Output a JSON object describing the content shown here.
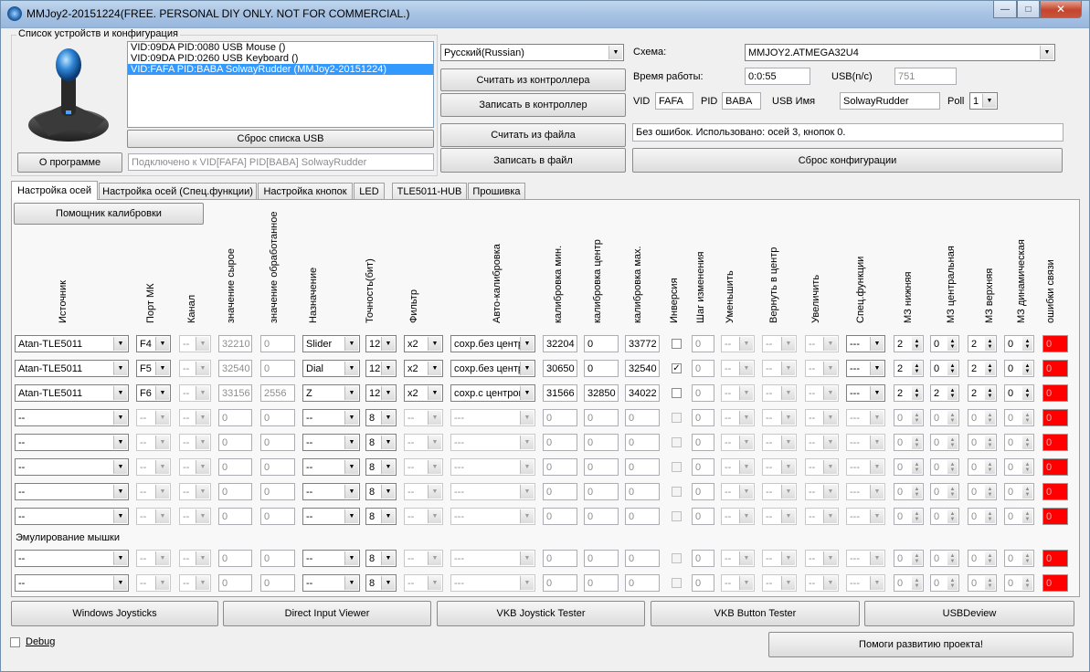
{
  "window": {
    "title": "MMJoy2-20151224(FREE. PERSONAL DIY ONLY. NOT FOR COMMERCIAL.)",
    "btn_min": "—",
    "btn_max": "□",
    "btn_close": "✕"
  },
  "devices": {
    "group_label": "Список устройств и конфигурация",
    "items": [
      "VID:09DA PID:0080 USB Mouse ()",
      "VID:09DA PID:0260 USB Keyboard ()",
      "VID:FAFA PID:BABA SolwayRudder (MMJoy2-20151224)"
    ],
    "reset_usb_label": "Сброс списка USB",
    "about_label": "О программе",
    "connected_text": "Подключено к VID[FAFA] PID[BABA] SolwayRudder"
  },
  "actions": {
    "language": "Русский(Russian)",
    "read_controller": "Считать из контроллера",
    "write_controller": "Записать в контроллер",
    "read_file": "Считать из файла",
    "write_file": "Записать в файл"
  },
  "config": {
    "scheme_label": "Схема:",
    "scheme_value": "MMJOY2.ATMEGA32U4",
    "uptime_label": "Время работы:",
    "uptime_value": "0:0:55",
    "usb_label": "USB(n/c)",
    "usb_value": "751",
    "vid_label": "VID",
    "vid_value": "FAFA",
    "pid_label": "PID",
    "pid_value": "BABA",
    "usbname_label": "USB Имя",
    "usbname_value": "SolwayRudder",
    "poll_label": "Poll",
    "poll_value": "1",
    "status_text": "Без ошибок. Использовано: осей  3, кнопок  0.",
    "reset_config_label": "Сброс конфигурации"
  },
  "tabs": [
    "Настройка осей",
    "Настройка осей (Спец.функции)",
    "Настройка кнопок",
    "LED",
    "TLE5011-HUB",
    "Прошивка"
  ],
  "calibration_helper": "Помощник калибровки",
  "columns": [
    "Источник",
    "Порт МК",
    "Канал",
    "значение сырое",
    "значение обработанное",
    "Назначение",
    "Точность(бит)",
    "Фильтр",
    "Авто-калибровка",
    "калибровка мин.",
    "калибровка центр",
    "калибровка мах.",
    "Инверсия",
    "Шаг изменения",
    "Уменьшить",
    "Вернуть в центр",
    "Увеличить",
    "Спец.функции",
    "МЗ нижняя",
    "МЗ центральная",
    "МЗ верхняя",
    "МЗ динамическая",
    "ошибки связи"
  ],
  "axes": [
    {
      "src": "Atan-TLE5011",
      "port": "F4",
      "ch": "--",
      "raw": "32210",
      "proc": "0",
      "dest": "Slider",
      "bits": "12",
      "filt": "x2",
      "auto": "сохр.без центр",
      "cmin": "32204",
      "cctr": "0",
      "cmax": "33772",
      "inv": false,
      "step": "0",
      "dec": "--",
      "ctr": "--",
      "inc": "--",
      "spec": "---",
      "dzl": "2",
      "dzc": "0",
      "dzu": "2",
      "dzd": "0",
      "err": "0",
      "active": true
    },
    {
      "src": "Atan-TLE5011",
      "port": "F5",
      "ch": "--",
      "raw": "32540",
      "proc": "0",
      "dest": "Dial",
      "bits": "12",
      "filt": "x2",
      "auto": "сохр.без центр",
      "cmin": "30650",
      "cctr": "0",
      "cmax": "32540",
      "inv": true,
      "step": "0",
      "dec": "--",
      "ctr": "--",
      "inc": "--",
      "spec": "---",
      "dzl": "2",
      "dzc": "0",
      "dzu": "2",
      "dzd": "0",
      "err": "0",
      "active": true
    },
    {
      "src": "Atan-TLE5011",
      "port": "F6",
      "ch": "--",
      "raw": "33156",
      "proc": "2556",
      "dest": "Z",
      "bits": "12",
      "filt": "x2",
      "auto": "сохр.с центрои",
      "cmin": "31566",
      "cctr": "32850",
      "cmax": "34022",
      "inv": false,
      "step": "0",
      "dec": "--",
      "ctr": "--",
      "inc": "--",
      "spec": "---",
      "dzl": "2",
      "dzc": "2",
      "dzu": "2",
      "dzd": "0",
      "err": "0",
      "active": true
    },
    {
      "src": "--",
      "port": "--",
      "ch": "--",
      "raw": "0",
      "proc": "0",
      "dest": "--",
      "bits": "8",
      "filt": "--",
      "auto": "---",
      "cmin": "0",
      "cctr": "0",
      "cmax": "0",
      "inv": false,
      "step": "0",
      "dec": "--",
      "ctr": "--",
      "inc": "--",
      "spec": "---",
      "dzl": "0",
      "dzc": "0",
      "dzu": "0",
      "dzd": "0",
      "err": "0",
      "active": false
    },
    {
      "src": "--",
      "port": "--",
      "ch": "--",
      "raw": "0",
      "proc": "0",
      "dest": "--",
      "bits": "8",
      "filt": "--",
      "auto": "---",
      "cmin": "0",
      "cctr": "0",
      "cmax": "0",
      "inv": false,
      "step": "0",
      "dec": "--",
      "ctr": "--",
      "inc": "--",
      "spec": "---",
      "dzl": "0",
      "dzc": "0",
      "dzu": "0",
      "dzd": "0",
      "err": "0",
      "active": false
    },
    {
      "src": "--",
      "port": "--",
      "ch": "--",
      "raw": "0",
      "proc": "0",
      "dest": "--",
      "bits": "8",
      "filt": "--",
      "auto": "---",
      "cmin": "0",
      "cctr": "0",
      "cmax": "0",
      "inv": false,
      "step": "0",
      "dec": "--",
      "ctr": "--",
      "inc": "--",
      "spec": "---",
      "dzl": "0",
      "dzc": "0",
      "dzu": "0",
      "dzd": "0",
      "err": "0",
      "active": false
    },
    {
      "src": "--",
      "port": "--",
      "ch": "--",
      "raw": "0",
      "proc": "0",
      "dest": "--",
      "bits": "8",
      "filt": "--",
      "auto": "---",
      "cmin": "0",
      "cctr": "0",
      "cmax": "0",
      "inv": false,
      "step": "0",
      "dec": "--",
      "ctr": "--",
      "inc": "--",
      "spec": "---",
      "dzl": "0",
      "dzc": "0",
      "dzu": "0",
      "dzd": "0",
      "err": "0",
      "active": false
    },
    {
      "src": "--",
      "port": "--",
      "ch": "--",
      "raw": "0",
      "proc": "0",
      "dest": "--",
      "bits": "8",
      "filt": "--",
      "auto": "---",
      "cmin": "0",
      "cctr": "0",
      "cmax": "0",
      "inv": false,
      "step": "0",
      "dec": "--",
      "ctr": "--",
      "inc": "--",
      "spec": "---",
      "dzl": "0",
      "dzc": "0",
      "dzu": "0",
      "dzd": "0",
      "err": "0",
      "active": false
    }
  ],
  "mouse_label": "Эмулирование мышки",
  "mouse_axes": [
    {
      "src": "--",
      "port": "--",
      "ch": "--",
      "raw": "0",
      "proc": "0",
      "dest": "--",
      "bits": "8",
      "filt": "--",
      "auto": "---",
      "cmin": "0",
      "cctr": "0",
      "cmax": "0",
      "inv": false,
      "step": "0",
      "dec": "--",
      "ctr": "--",
      "inc": "--",
      "spec": "---",
      "dzl": "0",
      "dzc": "0",
      "dzu": "0",
      "dzd": "0",
      "err": "0",
      "active": false
    },
    {
      "src": "--",
      "port": "--",
      "ch": "--",
      "raw": "0",
      "proc": "0",
      "dest": "--",
      "bits": "8",
      "filt": "--",
      "auto": "---",
      "cmin": "0",
      "cctr": "0",
      "cmax": "0",
      "inv": false,
      "step": "0",
      "dec": "--",
      "ctr": "--",
      "inc": "--",
      "spec": "---",
      "dzl": "0",
      "dzc": "0",
      "dzu": "0",
      "dzd": "0",
      "err": "0",
      "active": false
    }
  ],
  "tools": [
    "Windows Joysticks",
    "Direct Input Viewer",
    "VKB Joystick Tester",
    "VKB Button Tester",
    "USBDeview"
  ],
  "debug_label": "Debug",
  "help_label": "Помоги развитию проекта!",
  "colors": {
    "selection": "#3399ff",
    "error": "#ff0000"
  }
}
